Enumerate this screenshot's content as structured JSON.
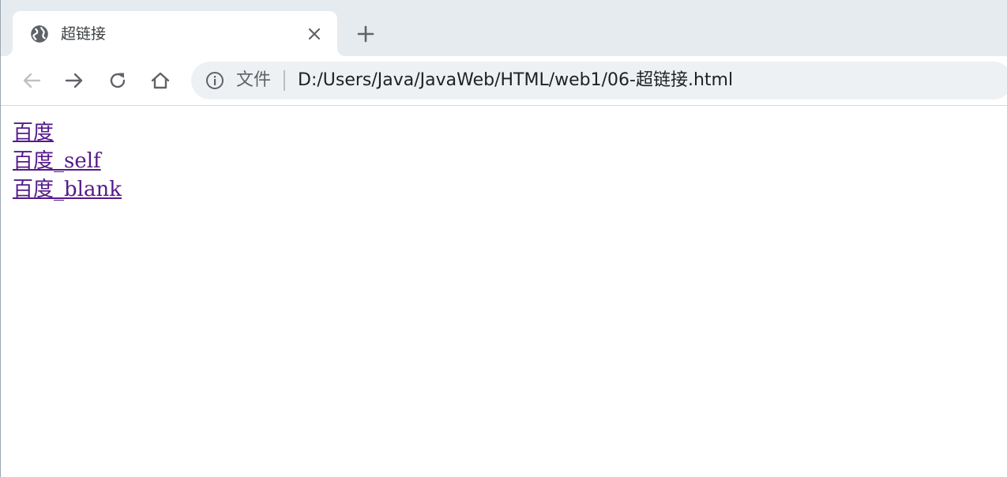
{
  "browser": {
    "tab": {
      "title": "超链接",
      "favicon_icon": "globe-icon",
      "close_icon": "close-icon"
    },
    "new_tab_icon": "plus-icon",
    "toolbar": {
      "back_icon": "arrow-left-icon",
      "forward_icon": "arrow-right-icon",
      "reload_icon": "reload-icon",
      "home_icon": "home-icon"
    },
    "omnibox": {
      "info_icon": "info-icon",
      "scheme_label": "文件",
      "url": "D:/Users/Java/JavaWeb/HTML/web1/06-超链接.html"
    }
  },
  "page": {
    "links": [
      {
        "label": "百度"
      },
      {
        "label": "百度_self"
      },
      {
        "label": "百度_blank"
      }
    ]
  },
  "colors": {
    "visited_link": "#551a8b",
    "tabstrip_bg": "#e6ebef",
    "omnibox_bg": "#eef1f3"
  }
}
